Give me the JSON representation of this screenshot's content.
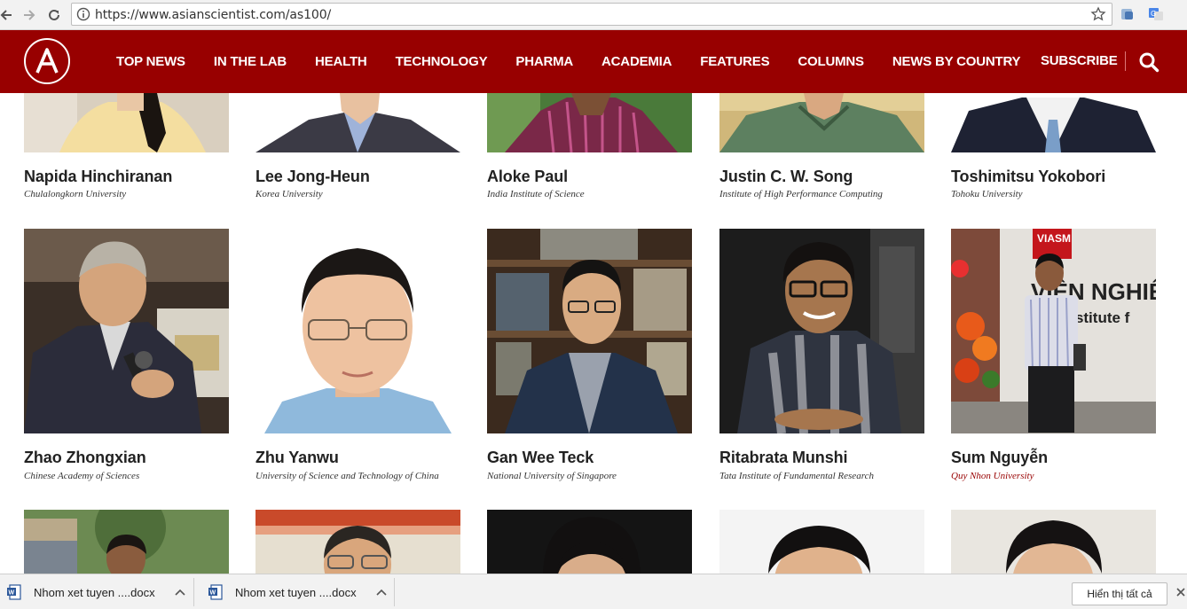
{
  "browser": {
    "url": "https://www.asianscientist.com/as100/"
  },
  "site": {
    "menu": [
      "TOP NEWS",
      "IN THE LAB",
      "HEALTH",
      "TECHNOLOGY",
      "PHARMA",
      "ACADEMIA",
      "FEATURES",
      "COLUMNS",
      "NEWS BY COUNTRY"
    ],
    "subscribe_label": "SUBSCRIBE",
    "brand_color": "#980000"
  },
  "people_row1": [
    {
      "name": "Napida Hinchiranan",
      "affiliation": "Chulalongkorn University"
    },
    {
      "name": "Lee Jong-Heun",
      "affiliation": "Korea University"
    },
    {
      "name": "Aloke Paul",
      "affiliation": "India Institute of Science"
    },
    {
      "name": "Justin C. W. Song",
      "affiliation": "Institute of High Performance Computing"
    },
    {
      "name": "Toshimitsu Yokobori",
      "affiliation": "Tohoku University"
    }
  ],
  "people_row2": [
    {
      "name": "Zhao Zhongxian",
      "affiliation": "Chinese Academy of Sciences"
    },
    {
      "name": "Zhu Yanwu",
      "affiliation": "University of Science and Technology of China"
    },
    {
      "name": "Gan Wee Teck",
      "affiliation": "National University of Singapore"
    },
    {
      "name": "Ritabrata Munshi",
      "affiliation": "Tata Institute of Fundamental Research"
    },
    {
      "name": "Sum Nguyễn",
      "affiliation": "Quy Nhon University",
      "highlight": true
    }
  ],
  "photo_sign": {
    "banner": "VIASM",
    "line1": "VIỆN NGHIÊN",
    "line2": "m Institute f"
  },
  "downloads": {
    "items": [
      "Nhom xet tuyen ....docx",
      "Nhom xet tuyen ....docx"
    ],
    "show_all_label": "Hiển thị tất cả"
  }
}
